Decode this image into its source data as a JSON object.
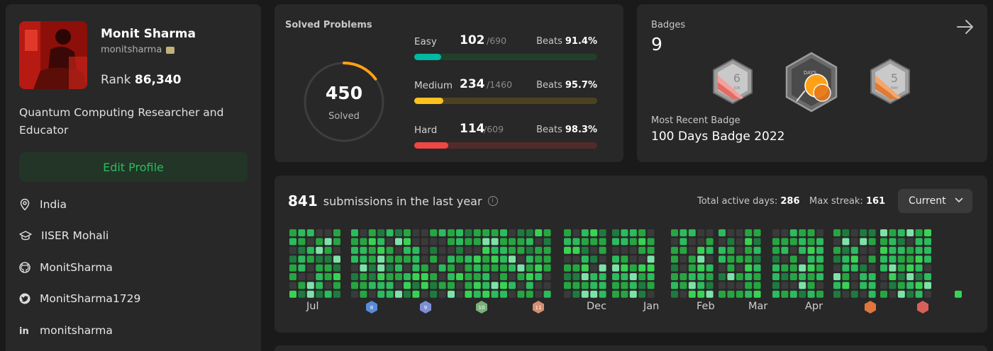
{
  "profile": {
    "name": "Monit Sharma",
    "username": "monitsharma",
    "rank_label": "Rank",
    "rank_value": "86,340",
    "bio": "Quantum Computing Researcher and Educator",
    "edit_button": "Edit Profile",
    "info": [
      {
        "icon": "location-icon",
        "text": "India"
      },
      {
        "icon": "school-icon",
        "text": "IISER Mohali"
      },
      {
        "icon": "github-icon",
        "text": "MonitSharma"
      },
      {
        "icon": "twitter-icon",
        "text": "MonitSharma1729"
      },
      {
        "icon": "linkedin-icon",
        "text": "monitsharma"
      }
    ]
  },
  "solved": {
    "title": "Solved Problems",
    "total": "450",
    "total_label": "Solved",
    "ring_fraction": 0.15,
    "difficulties": [
      {
        "name": "Easy",
        "count": "102",
        "total": "/690",
        "beats_label": "Beats",
        "beats": "91.4%",
        "fraction": 0.148,
        "color": "#00b8a3",
        "track": "#21402b"
      },
      {
        "name": "Medium",
        "count": "234",
        "total": "/1460",
        "beats_label": "Beats",
        "beats": "95.7%",
        "fraction": 0.16,
        "color": "#ffc01e",
        "track": "#4d4220"
      },
      {
        "name": "Hard",
        "count": "114",
        "total": "/609",
        "beats_label": "Beats",
        "beats": "98.3%",
        "fraction": 0.187,
        "color": "#ef4743",
        "track": "#512b2a"
      }
    ]
  },
  "badges": {
    "title": "Badges",
    "count": "9",
    "recent_label": "Most Recent Badge",
    "recent_name": "100 Days Badge 2022",
    "items": [
      {
        "icon": "june-badge-icon",
        "label": "6",
        "sub": "JUN"
      },
      {
        "icon": "100-days-badge-icon",
        "label": "DAYS",
        "sub": ""
      },
      {
        "icon": "may-badge-icon",
        "label": "5",
        "sub": "MAY"
      }
    ]
  },
  "submissions": {
    "count": "841",
    "label": "submissions in the last year",
    "active_label": "Total active days:",
    "active_value": "286",
    "streak_label": "Max streak:",
    "streak_value": "161",
    "dropdown": "Current",
    "months": [
      "Jul",
      "Dec",
      "Jan",
      "Feb",
      "Mar",
      "Apr"
    ],
    "mini_badges": [
      {
        "label": "8",
        "color": "#5b8ad8"
      },
      {
        "label": "9",
        "color": "#7e8fd4"
      },
      {
        "label": "10",
        "color": "#7bb07a"
      },
      {
        "label": "11",
        "color": "#d58e6f"
      },
      {
        "label": "",
        "color": "#e0753d"
      },
      {
        "label": "",
        "color": "#d9605a"
      }
    ]
  },
  "colors": {
    "green_accent": "#2cbb5d",
    "card_bg": "#282828",
    "page_bg": "#1a1a1a"
  }
}
